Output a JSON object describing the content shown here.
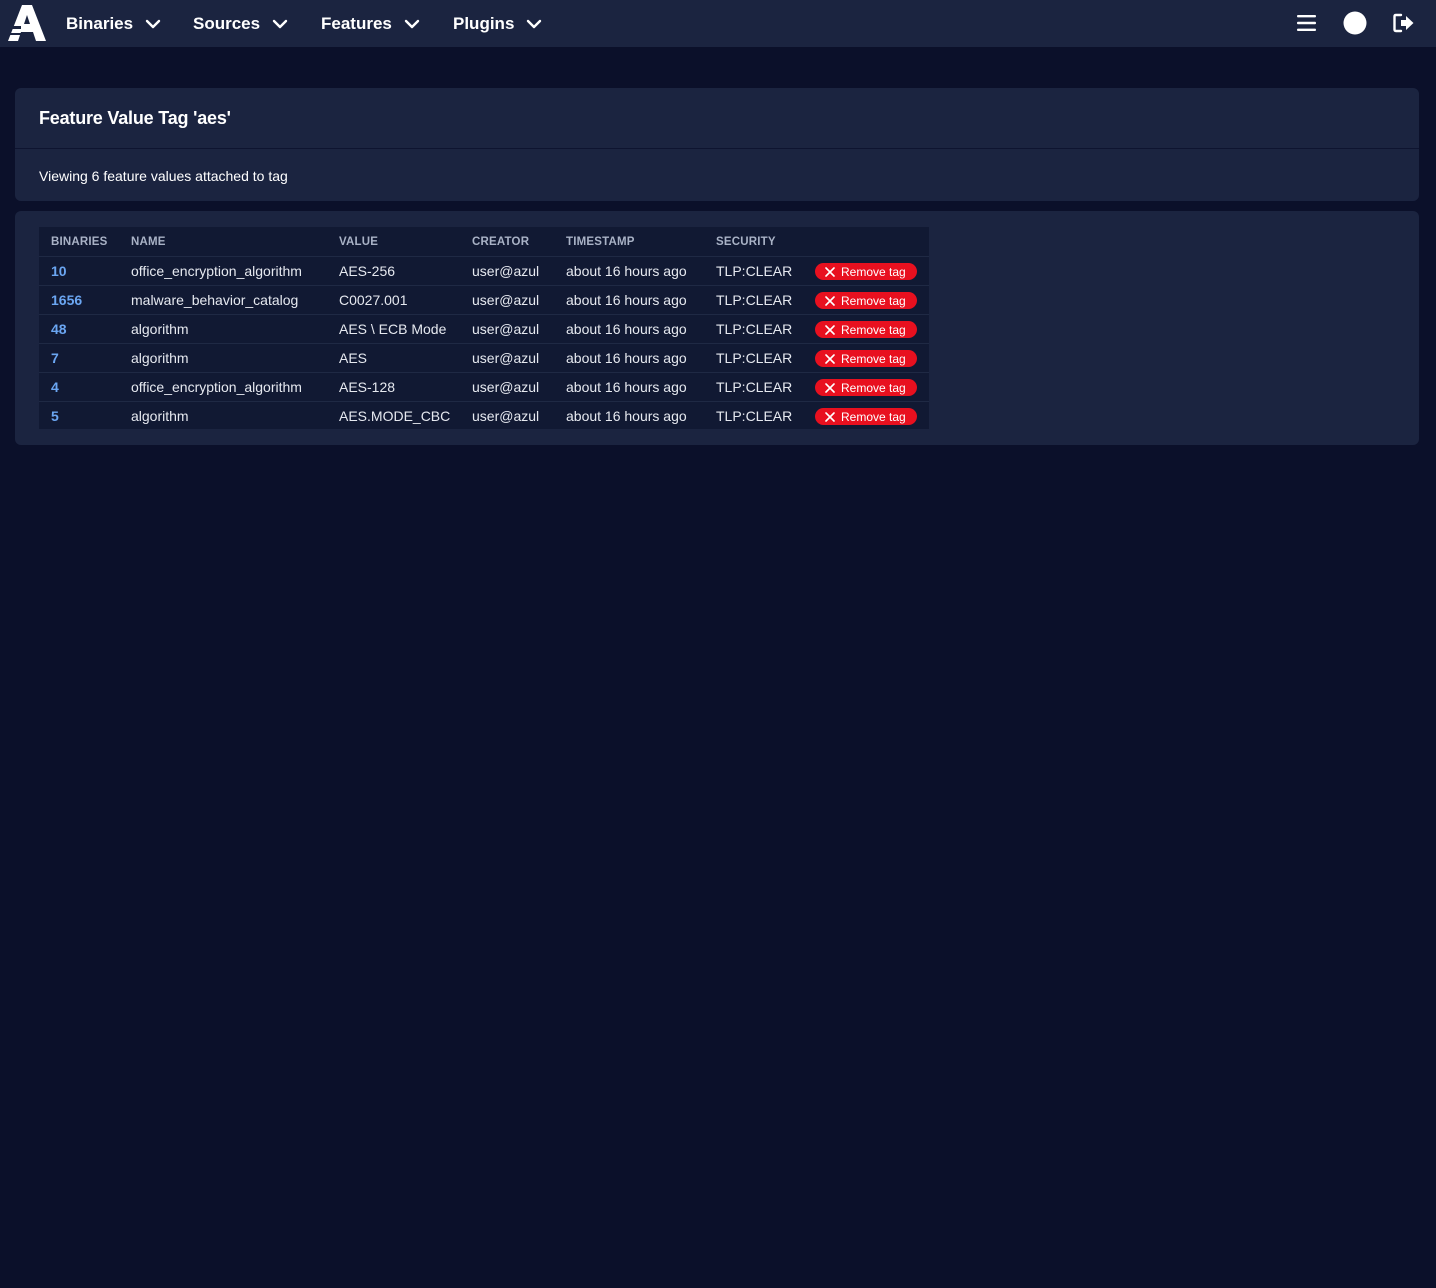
{
  "nav": {
    "items": [
      {
        "label": "Binaries"
      },
      {
        "label": "Sources"
      },
      {
        "label": "Features"
      },
      {
        "label": "Plugins"
      }
    ]
  },
  "header": {
    "title": "Feature Value Tag 'aes'",
    "subtitle": "Viewing 6 feature values attached to tag"
  },
  "table": {
    "columns": [
      "BINARIES",
      "NAME",
      "VALUE",
      "CREATOR",
      "TIMESTAMP",
      "SECURITY"
    ],
    "remove_label": "Remove tag",
    "rows": [
      {
        "binaries": "10",
        "name": "office_encryption_algorithm",
        "value": "AES-256",
        "creator": "user@azul",
        "timestamp": "about 16 hours ago",
        "security": "TLP:CLEAR"
      },
      {
        "binaries": "1656",
        "name": "malware_behavior_catalog",
        "value": "C0027.001",
        "creator": "user@azul",
        "timestamp": "about 16 hours ago",
        "security": "TLP:CLEAR"
      },
      {
        "binaries": "48",
        "name": "algorithm",
        "value": "AES \\ ECB Mode",
        "creator": "user@azul",
        "timestamp": "about 16 hours ago",
        "security": "TLP:CLEAR"
      },
      {
        "binaries": "7",
        "name": "algorithm",
        "value": "AES",
        "creator": "user@azul",
        "timestamp": "about 16 hours ago",
        "security": "TLP:CLEAR"
      },
      {
        "binaries": "4",
        "name": "office_encryption_algorithm",
        "value": "AES-128",
        "creator": "user@azul",
        "timestamp": "about 16 hours ago",
        "security": "TLP:CLEAR"
      },
      {
        "binaries": "5",
        "name": "algorithm",
        "value": "AES.MODE_CBC",
        "creator": "user@azul",
        "timestamp": "about 16 hours ago",
        "security": "TLP:CLEAR"
      }
    ]
  },
  "colors": {
    "background": "#0b102a",
    "panel": "#1b2440",
    "link": "#6ba6f2",
    "danger": "#e8101f"
  }
}
